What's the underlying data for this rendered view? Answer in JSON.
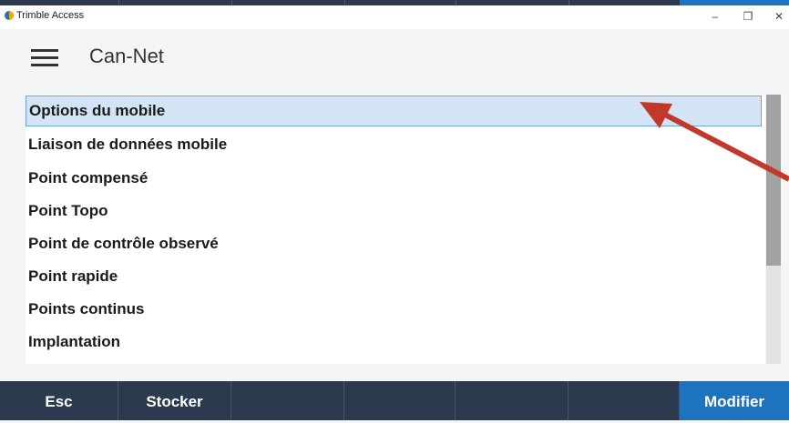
{
  "window": {
    "app_title": "Trimble Access",
    "controls": {
      "minimize": "–",
      "restore": "❐",
      "close": "✕"
    }
  },
  "header": {
    "menu_icon": "hamburger-menu-icon",
    "title": "Can-Net"
  },
  "list": {
    "items": [
      {
        "label": "Options du mobile",
        "selected": true
      },
      {
        "label": "Liaison de données mobile",
        "selected": false
      },
      {
        "label": "Point compensé",
        "selected": false
      },
      {
        "label": "Point Topo",
        "selected": false
      },
      {
        "label": "Point de contrôle observé",
        "selected": false
      },
      {
        "label": "Point rapide",
        "selected": false
      },
      {
        "label": "Points continus",
        "selected": false
      },
      {
        "label": "Implantation",
        "selected": false
      }
    ]
  },
  "softkeys": [
    {
      "label": "Esc"
    },
    {
      "label": "Stocker"
    },
    {
      "label": ""
    },
    {
      "label": ""
    },
    {
      "label": ""
    },
    {
      "label": ""
    },
    {
      "label": "Modifier",
      "primary": true
    }
  ],
  "colors": {
    "accent": "#1e73be",
    "dark_bar": "#2b3a4f",
    "selection": "#d3e4f4",
    "annotation_arrow": "#c0392b"
  }
}
